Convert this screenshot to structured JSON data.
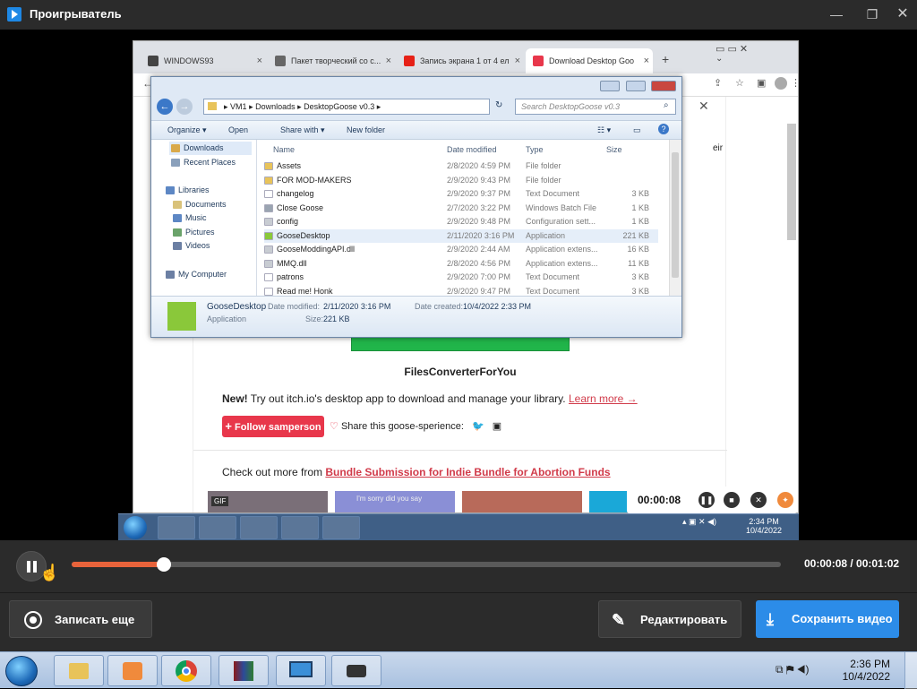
{
  "player": {
    "title": "Проигрыватель",
    "current_time": "00:00:08 / 00:01:02",
    "progress_fraction": 0.13,
    "record_again_label": "Записать еще",
    "edit_label": "Редактировать",
    "save_label": "Сохранить видео"
  },
  "recording_overlay": {
    "time": "00:00:08"
  },
  "chrome": {
    "tabs": [
      {
        "label": "WINDOWS93",
        "color": "#444"
      },
      {
        "label": "Пакет творческий со с...",
        "color": "#666"
      },
      {
        "label": "Запись экрана 1 от 4 ел",
        "color": "#e62117"
      },
      {
        "label": "Download Desktop Goo",
        "color": "#e8374b",
        "active": true
      }
    ]
  },
  "page": {
    "button_text": "FilesConverterForYou",
    "new_text_bold": "New!",
    "new_text": "Try out itch.io's desktop app to download and manage your library.",
    "learn_more": "Learn more →",
    "follow_label": "Follow samperson",
    "share_text": "Share this goose-sperience:",
    "check_out_text": "Check out more from",
    "bundle_link": "Bundle Submission for Indie Bundle for Abortion Funds",
    "thumb_badge": "GIF",
    "thumb2_text": "I'm sorry did you say",
    "side_text": "eir"
  },
  "explorer": {
    "breadcrumb": [
      "VM1",
      "Downloads",
      "DesktopGoose v0.3"
    ],
    "search_placeholder": "Search DesktopGoose v0.3",
    "commands": [
      "Organize ▾",
      "Open",
      "Share with ▾",
      "New folder"
    ],
    "nav": [
      {
        "label": "Downloads",
        "color": "#d9a94a"
      },
      {
        "label": "Recent Places",
        "color": "#8aa0bb"
      },
      {
        "label": "Libraries",
        "color": "#5d87c4"
      },
      {
        "label": "Documents",
        "color": "#d9c27a"
      },
      {
        "label": "Music",
        "color": "#5d87c4"
      },
      {
        "label": "Pictures",
        "color": "#6aa36a"
      },
      {
        "label": "Videos",
        "color": "#6b7fa3"
      },
      {
        "label": "My Computer",
        "color": "#6b7fa3"
      }
    ],
    "columns": {
      "name": "Name",
      "date": "Date modified",
      "type": "Type",
      "size": "Size"
    },
    "files": [
      {
        "name": "Assets",
        "date": "2/8/2020 4:59 PM",
        "type": "File folder",
        "size": "",
        "icon": "#e8c35a"
      },
      {
        "name": "FOR MOD-MAKERS",
        "date": "2/9/2020 9:43 PM",
        "type": "File folder",
        "size": "",
        "icon": "#e8c35a"
      },
      {
        "name": "changelog",
        "date": "2/9/2020 9:37 PM",
        "type": "Text Document",
        "size": "3 KB",
        "icon": "#ffffff"
      },
      {
        "name": "Close Goose",
        "date": "2/7/2020 3:22 PM",
        "type": "Windows Batch File",
        "size": "1 KB",
        "icon": "#9aa4b1"
      },
      {
        "name": "config",
        "date": "2/9/2020 9:48 PM",
        "type": "Configuration sett...",
        "size": "1 KB",
        "icon": "#c8ccd2"
      },
      {
        "name": "GooseDesktop",
        "date": "2/11/2020 3:16 PM",
        "type": "Application",
        "size": "221 KB",
        "icon": "#8ac83a",
        "selected": true
      },
      {
        "name": "GooseModdingAPI.dll",
        "date": "2/9/2020 2:44 AM",
        "type": "Application extens...",
        "size": "16 KB",
        "icon": "#c8ccd2"
      },
      {
        "name": "MMQ.dll",
        "date": "2/8/2020 4:56 PM",
        "type": "Application extens...",
        "size": "11 KB",
        "icon": "#c8ccd2"
      },
      {
        "name": "patrons",
        "date": "2/9/2020 7:00 PM",
        "type": "Text Document",
        "size": "3 KB",
        "icon": "#ffffff"
      },
      {
        "name": "Read me! Honk",
        "date": "2/9/2020 9:47 PM",
        "type": "Text Document",
        "size": "3 KB",
        "icon": "#ffffff"
      }
    ],
    "details": {
      "name": "GooseDesktop",
      "kind": "Application",
      "modified_label": "Date modified:",
      "modified": "2/11/2020 3:16 PM",
      "created_label": "Date created:",
      "created": "10/4/2022 2:33 PM",
      "size_label": "Size:",
      "size": "221 KB"
    }
  },
  "recorded_taskbar": {
    "time": "2:34 PM",
    "date": "10/4/2022"
  },
  "taskbar": {
    "time": "2:36 PM",
    "date": "10/4/2022"
  },
  "colors": {
    "accent_orange": "#e8633b",
    "save_blue": "#2c8ce8",
    "itch_red": "#e8374b"
  }
}
